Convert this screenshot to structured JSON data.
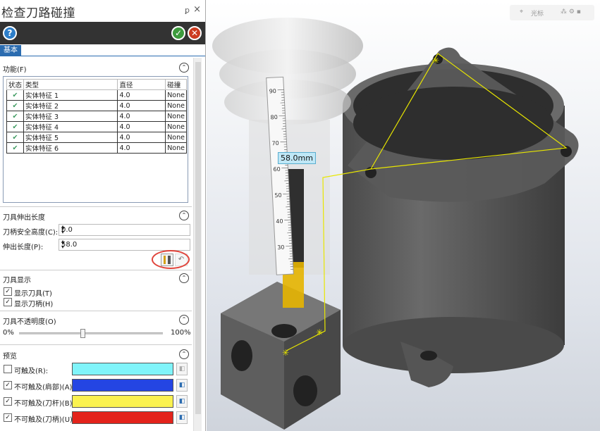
{
  "panel": {
    "title": "检查刀路碰撞",
    "pin": "ꝑ",
    "close": "×",
    "help": "?",
    "tab": "基本"
  },
  "function_section": {
    "title": "功能(F)",
    "headers": [
      "状态",
      "类型",
      "直径",
      "碰撞"
    ],
    "rows": [
      {
        "type": "实体特征 1",
        "diameter": "4.0",
        "collision": "None"
      },
      {
        "type": "实体特征 2",
        "diameter": "4.0",
        "collision": "None"
      },
      {
        "type": "实体特征 3",
        "diameter": "4.0",
        "collision": "None"
      },
      {
        "type": "实体特征 4",
        "diameter": "4.0",
        "collision": "None"
      },
      {
        "type": "实体特征 5",
        "diameter": "4.0",
        "collision": "None"
      },
      {
        "type": "实体特征 6",
        "diameter": "4.0",
        "collision": "None"
      }
    ]
  },
  "tool_length": {
    "title": "刀具伸出长度",
    "holder_clearance_label": "刀柄安全高度(C):",
    "holder_clearance_value": "0.0",
    "extension_label": "伸出长度(P):",
    "extension_value": "58.0"
  },
  "tool_display": {
    "title": "刀具显示",
    "show_tool": "显示刀具(T)",
    "show_holder": "显示刀柄(H)"
  },
  "opacity": {
    "title": "刀具不透明度(O)",
    "min": "0%",
    "max": "100%",
    "value_percent": 45
  },
  "preview": {
    "title": "预览",
    "items": [
      {
        "label": "可触及(R):",
        "checked": false,
        "color": "#80f4fa"
      },
      {
        "label": "不可触及(肩部)(A):",
        "checked": true,
        "color": "#2445e3"
      },
      {
        "label": "不可触及(刀杆)(B):",
        "checked": true,
        "color": "#fbf250"
      },
      {
        "label": "不可触及(刀柄)(U):",
        "checked": true,
        "color": "#e3231b"
      }
    ]
  },
  "viewport": {
    "toolbar_label": "光标",
    "measure_label": "58.0mm",
    "ruler_ticks": [
      "90",
      "80",
      "70",
      "60",
      "50",
      "40",
      "30"
    ]
  }
}
